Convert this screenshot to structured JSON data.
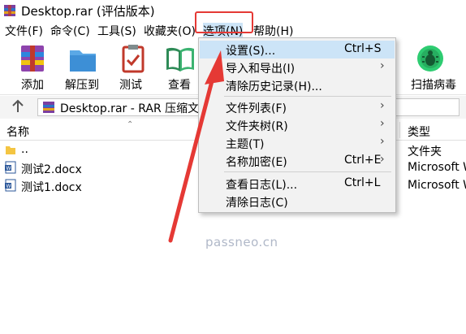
{
  "title_bar": {
    "title": "Desktop.rar (评估版本)"
  },
  "menubar": [
    {
      "label": "文件(F)"
    },
    {
      "label": "命令(C)"
    },
    {
      "label": "工具(S)"
    },
    {
      "label": "收藏夹(O)"
    },
    {
      "label": "选项(N)"
    },
    {
      "label": "帮助(H)"
    }
  ],
  "toolbar": {
    "add": "添加",
    "extract": "解压到",
    "test": "测试",
    "view": "查看",
    "scan": "扫描病毒"
  },
  "address": {
    "path": "Desktop.rar - RAR 压缩文件"
  },
  "columns": {
    "name": "名称",
    "type": "类型"
  },
  "rows": [
    {
      "name": "..",
      "type": "文件夹"
    },
    {
      "name": "测试2.docx",
      "type": "Microsoft W"
    },
    {
      "name": "测试1.docx",
      "type": "Microsoft W"
    }
  ],
  "dropdown": {
    "items": [
      {
        "label": "设置(S)...",
        "shortcut": "Ctrl+S",
        "submenu": false
      },
      {
        "label": "导入和导出(I)",
        "shortcut": "",
        "submenu": true
      },
      {
        "label": "清除历史记录(H)...",
        "shortcut": "",
        "submenu": false
      },
      {
        "label": "文件列表(F)",
        "shortcut": "",
        "submenu": true
      },
      {
        "label": "文件夹树(R)",
        "shortcut": "",
        "submenu": true
      },
      {
        "label": "主题(T)",
        "shortcut": "",
        "submenu": true
      },
      {
        "label": "名称加密(E)",
        "shortcut": "Ctrl+E",
        "submenu": true
      },
      {
        "label": "查看日志(L)...",
        "shortcut": "Ctrl+L",
        "submenu": false
      },
      {
        "label": "清除日志(C)",
        "shortcut": "",
        "submenu": false
      }
    ]
  },
  "watermark": "passneo.cn",
  "colors": {
    "highlight_border": "#e53935",
    "hover": "#cce4f7",
    "menu_bg": "#f2f2f2"
  },
  "icons": [
    "winrar-icon",
    "add-icon",
    "extract-icon",
    "test-icon",
    "view-icon",
    "scan-virus-icon",
    "up-arrow-icon",
    "folder-icon",
    "docx-icon",
    "submenu-arrow-icon"
  ]
}
